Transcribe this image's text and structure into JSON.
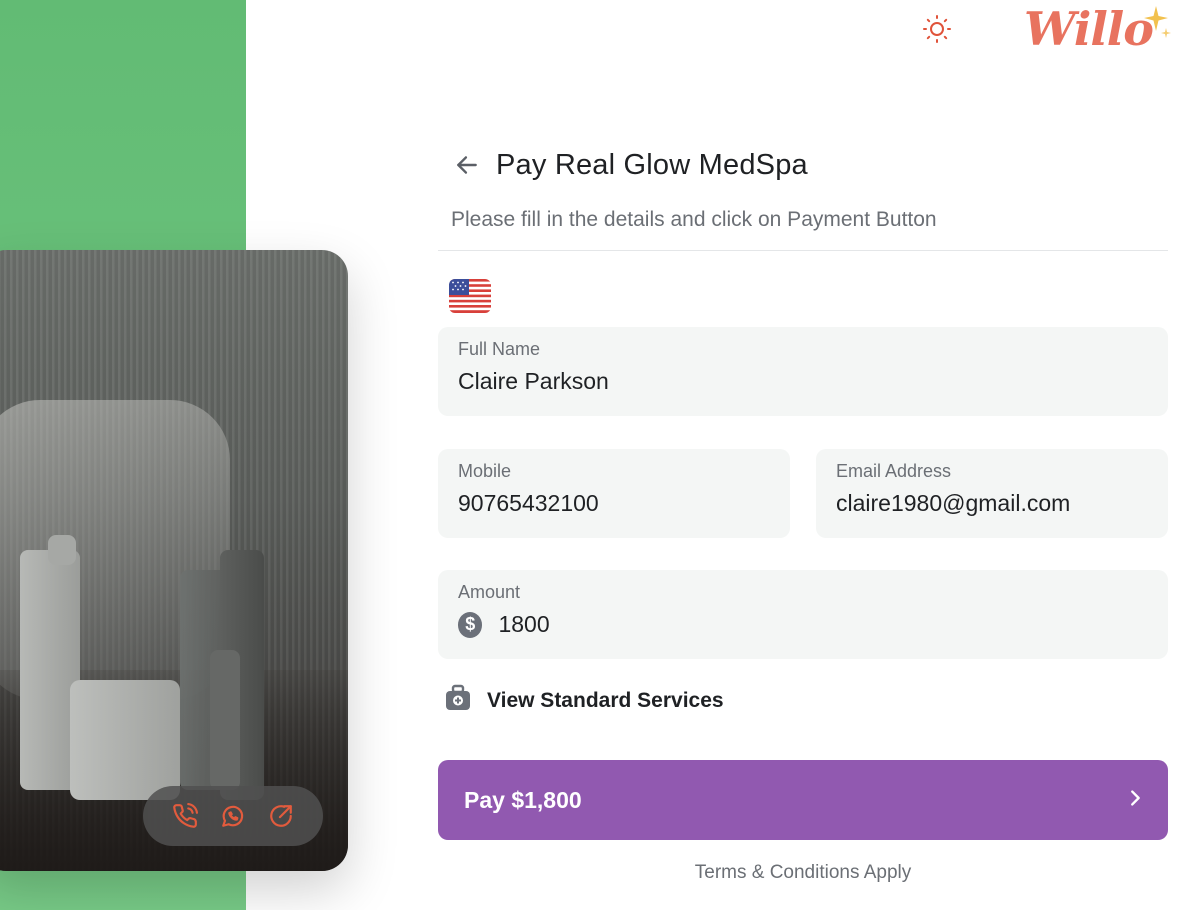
{
  "brand": {
    "logo_text": "Willo",
    "accent_color": "#e8735f",
    "theme_icon": "sun-icon"
  },
  "form": {
    "title": "Pay Real Glow MedSpa",
    "subtitle": "Please fill in the details and click on Payment Button",
    "country_flag": "us-flag-icon",
    "full_name": {
      "label": "Full Name",
      "value": "Claire Parkson"
    },
    "mobile": {
      "label": "Mobile",
      "value": "90765432100"
    },
    "email": {
      "label": "Email Address",
      "value": "claire1980@gmail.com"
    },
    "amount": {
      "label": "Amount",
      "currency_symbol": "$",
      "value": "1800"
    },
    "services_link": "View Standard Services",
    "pay_button": {
      "label": "Pay $1,800",
      "color": "#9159b0"
    },
    "terms": "Terms & Conditions Apply"
  },
  "contact_actions": [
    {
      "icon": "phone-icon"
    },
    {
      "icon": "whatsapp-icon"
    },
    {
      "icon": "share-arrow-icon"
    }
  ]
}
